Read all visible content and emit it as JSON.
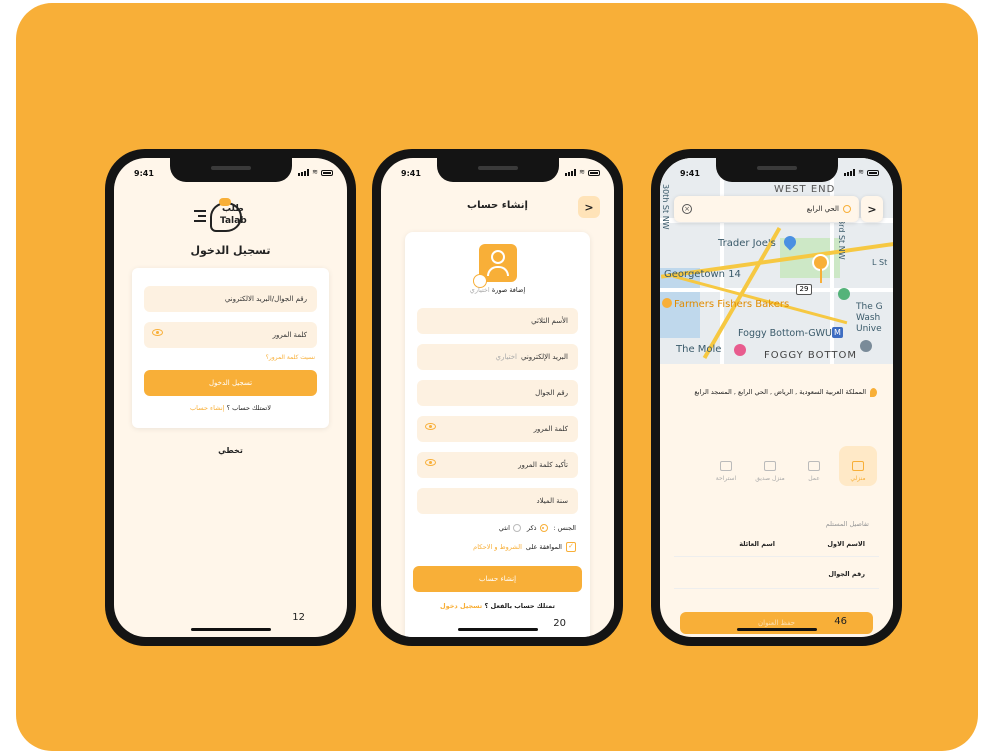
{
  "colors": {
    "brand": "#F8AF38",
    "background": "#FFF6EA",
    "frame": "#141414"
  },
  "phones": {
    "login": {
      "time": "9:41",
      "logo_text": "Talab",
      "logo_arabic": "طلب",
      "title": "تسجيل الدخول",
      "phone_email_placeholder": "رقم الجوال/البريد الالكتروني",
      "password_placeholder": "كلمة المرور",
      "forgot_password": "نسيت كلمة المرور؟",
      "login_button": "تسجيل الدخول",
      "no_account": "لاتمتلك حساب ؟",
      "create_account_link": "إنشاء حساب",
      "skip": "تخطي",
      "page_number": "12"
    },
    "register": {
      "time": "9:41",
      "title": "إنشاء حساب",
      "add_photo": "إضافة صورة",
      "optional": "اختياري",
      "full_name": "الأسم الثلاثي",
      "email": "البريد الإلكتروني",
      "email_optional": "اختياري",
      "phone": "رقم الجوال",
      "password": "كلمة المرور",
      "confirm_password": "تأكيد كلمة المرور",
      "birth_year": "سنة الميلاد",
      "gender_label": "الجنس :",
      "gender_male": "ذكر",
      "gender_female": "انثي",
      "terms_prefix": "الموافقة على",
      "terms_link": "الشروط و الاحكام",
      "create_button": "إنشاء حساب",
      "have_account": "تمتلك حساب بالفعل ؟",
      "login_link": "تسجيل دخول",
      "page_number": "20"
    },
    "address": {
      "time": "9:41",
      "search_value": "الحي الرابع",
      "map_labels": {
        "west_end": "WEST END",
        "traders": "Trader Joe's",
        "georgetown": "Georgetown 14",
        "farmers": "Farmers Fishers Bakers",
        "foggy_gwu": "Foggy Bottom-GWU",
        "mole": "The Mole",
        "foggy": "FOGGY BOTTOM",
        "st30": "30th St NW",
        "st23": "23rd St NW",
        "lst": "L St",
        "wash": "The G Wash Unive",
        "cafe": "afe",
        "route": "29"
      },
      "address_text": "المملكة العربية السعودية , الرياض , الحي الرابع , المسجد الرابع",
      "categories": [
        {
          "label": "منزلي",
          "icon": "home-icon",
          "active": true
        },
        {
          "label": "عمل",
          "icon": "work-icon",
          "active": false
        },
        {
          "label": "منزل صديق",
          "icon": "friend-house-icon",
          "active": false
        },
        {
          "label": "استراحة",
          "icon": "rest-house-icon",
          "active": false
        }
      ],
      "recipient_details": "تفاصيل المستلم",
      "first_name": "الاسم الاول",
      "last_name": "اسم العائلة",
      "phone": "رقم الجوال",
      "save_button": "حفظ العنوان",
      "page_number": "46"
    }
  }
}
